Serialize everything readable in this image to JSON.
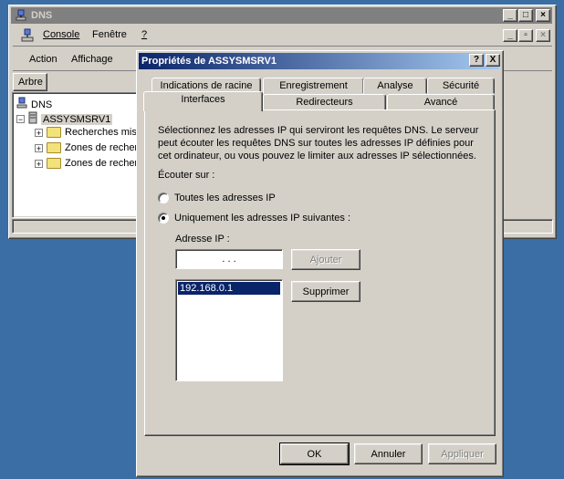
{
  "dns_window": {
    "title": "DNS",
    "menu": {
      "console": "Console",
      "window": "Fenêtre",
      "help": "?"
    },
    "toolbar": {
      "action": "Action",
      "view": "Affichage"
    },
    "tree_tab": "Arbre",
    "tree": {
      "root": "DNS",
      "server": "ASSYSMSRV1",
      "items": [
        "Recherches misc",
        "Zones de recher",
        "Zones de recher"
      ]
    }
  },
  "dialog": {
    "title": "Propriétés de ASSYSMSRV1",
    "help_label": "?",
    "close_label": "X",
    "tabs_back": [
      "Indications de racine",
      "Enregistrement",
      "Analyse",
      "Sécurité"
    ],
    "tabs_front": [
      "Interfaces",
      "Redirecteurs",
      "Avancé"
    ],
    "description": "Sélectionnez les adresses IP qui serviront les requêtes DNS. Le serveur peut écouter les requêtes DNS sur toutes les adresses IP définies pour cet ordinateur, ou vous pouvez le limiter aux adresses IP sélectionnées.",
    "listen_label": "Écouter sur :",
    "radio_all": "Toutes les adresses IP",
    "radio_only": "Uniquement les adresses IP suivantes :",
    "ip_label": "Adresse IP :",
    "ip_input_value": ".       .       .",
    "add_button": "Ajouter",
    "remove_button": "Supprimer",
    "ip_list": [
      "192.168.0.1"
    ],
    "ok": "OK",
    "cancel": "Annuler",
    "apply": "Appliquer"
  }
}
